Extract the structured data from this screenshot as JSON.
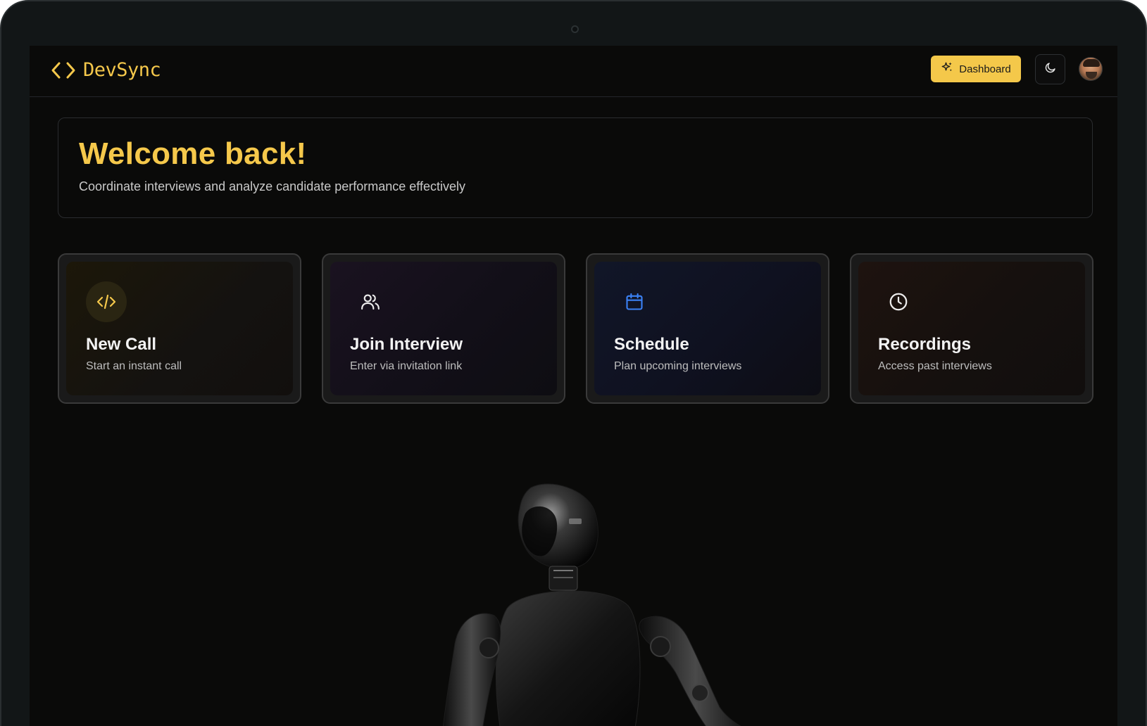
{
  "brand": {
    "name": "DevSync",
    "icon": "code-brackets-icon",
    "color": "#f5c84b"
  },
  "header": {
    "dashboard_label": "Dashboard",
    "dashboard_icon": "sparkles-icon",
    "theme_icon": "moon-icon",
    "avatar_icon": "user-avatar"
  },
  "welcome": {
    "title": "Welcome back!",
    "subtitle": "Coordinate interviews and analyze candidate performance effectively"
  },
  "actions": [
    {
      "title": "New Call",
      "description": "Start an instant call",
      "icon": "code-icon"
    },
    {
      "title": "Join Interview",
      "description": "Enter via invitation link",
      "icon": "users-icon"
    },
    {
      "title": "Schedule",
      "description": "Plan upcoming interviews",
      "icon": "calendar-icon"
    },
    {
      "title": "Recordings",
      "description": "Access past interviews",
      "icon": "clock-icon"
    }
  ],
  "colors": {
    "accent": "#f5c84b",
    "background": "#0a0a09",
    "frame": "#121617",
    "schedule_icon": "#3b82f6"
  }
}
